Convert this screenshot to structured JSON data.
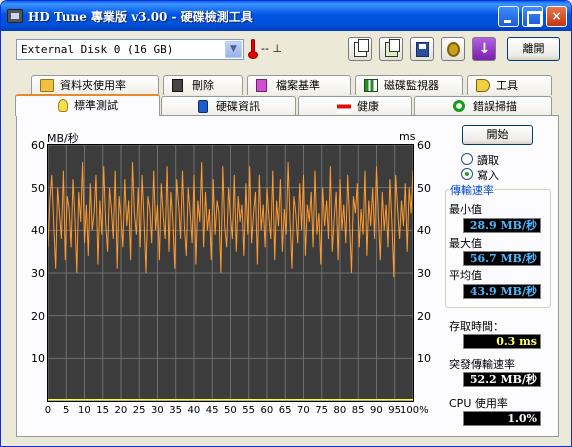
{
  "window": {
    "title": "HD Tune 專業版 v3.00 - 硬碟檢測工具",
    "minimize": "_",
    "maximize": "□",
    "close": "×"
  },
  "toolbar": {
    "drive": "External Disk 0 (16 GB)",
    "temperature": "-- ⊥",
    "exit_label": "離開",
    "download_arrow": "↓"
  },
  "tabs_top": [
    {
      "label": "資料夾使用率",
      "icon": "folder-icon"
    },
    {
      "label": "刪除",
      "icon": "trash-icon"
    },
    {
      "label": "檔案基準",
      "icon": "file-benchmark-icon"
    },
    {
      "label": "磁碟監視器",
      "icon": "disk-monitor-icon"
    },
    {
      "label": "工具",
      "icon": "speaker-icon"
    }
  ],
  "tabs_bottom": [
    {
      "label": "標準測試",
      "icon": "lightbulb-icon",
      "active": true
    },
    {
      "label": "硬碟資訊",
      "icon": "info-icon"
    },
    {
      "label": "健康",
      "icon": "health-cross-icon"
    },
    {
      "label": "錯誤掃描",
      "icon": "magnifier-icon"
    }
  ],
  "controls": {
    "start_label": "開始",
    "read_label": "讀取",
    "write_label": "寫入",
    "mode": "write"
  },
  "stats": {
    "transfer_rate_title": "傳輸速率",
    "min_label": "最小值",
    "min_value": "28.9 MB/秒",
    "max_label": "最大值",
    "max_value": "56.7 MB/秒",
    "avg_label": "平均值",
    "avg_value": "43.9 MB/秒",
    "access_label": "存取時間：",
    "access_value": "0.3 ms",
    "burst_label": "突發傳輸速率",
    "burst_value": "52.2 MB/秒",
    "cpu_label": "CPU 使用率",
    "cpu_value": "1.0%"
  },
  "colors": {
    "transfer": "#ff9a2e",
    "access": "#ffff40",
    "chart_bg": "#3c3c3c",
    "grid": "#6e6e6e"
  },
  "chart_data": {
    "type": "line",
    "left_axis_label": "MB/秒",
    "right_axis_label": "ms",
    "ylim": [
      0,
      60
    ],
    "y_ticks": [
      0,
      10,
      20,
      30,
      40,
      50,
      60
    ],
    "x_ticks": [
      "0",
      "5",
      "10",
      "15",
      "20",
      "25",
      "30",
      "35",
      "40",
      "45",
      "50",
      "55",
      "60",
      "65",
      "70",
      "75",
      "80",
      "85",
      "90",
      "95",
      "100%"
    ],
    "series": [
      {
        "values": [
          36,
          47,
          53,
          41,
          31,
          50,
          44,
          38,
          54,
          33,
          48,
          45,
          36,
          52,
          43,
          30,
          49,
          42,
          56,
          37,
          46,
          34,
          51,
          40,
          44,
          53,
          32,
          47,
          39,
          55,
          42,
          35,
          50,
          45,
          38,
          54,
          31,
          48,
          43,
          36,
          52,
          41,
          47,
          33,
          56,
          44,
          39,
          50,
          36,
          53,
          42,
          30,
          48,
          45,
          37,
          54,
          40,
          46,
          33,
          51,
          43,
          38,
          55,
          35,
          49,
          42,
          31,
          52,
          46,
          38,
          54,
          41,
          34,
          50,
          44,
          37,
          53,
          32,
          47,
          42,
          56,
          36,
          49,
          40,
          45,
          33,
          52,
          39,
          47,
          44,
          30,
          55,
          41,
          36,
          50,
          43,
          38,
          53,
          35,
          48,
          42,
          46,
          34,
          51,
          39,
          55,
          37,
          44,
          49,
          32,
          53,
          40,
          46,
          36,
          50,
          43,
          38,
          54,
          33,
          47,
          41,
          52,
          35,
          45,
          39,
          56,
          42,
          31,
          48,
          44,
          37,
          51,
          40,
          53,
          34,
          46,
          42,
          49,
          36,
          54,
          39,
          44,
          32,
          50,
          41,
          47,
          38,
          55,
          35,
          43,
          49,
          33,
          52,
          40,
          46,
          37,
          53,
          42,
          30,
          48,
          44,
          51,
          36,
          45,
          39,
          54,
          34,
          47,
          41,
          50,
          38,
          55,
          43,
          33,
          49,
          40,
          46,
          36,
          52,
          42,
          29,
          53,
          45,
          38,
          47,
          41,
          51,
          35,
          50,
          44,
          54
        ]
      },
      {
        "values": [
          0.3,
          0.3,
          0.3,
          0.3,
          0.3,
          0.3,
          0.3,
          0.3,
          0.3,
          0.3,
          0.3,
          0.3,
          0.3,
          0.3,
          0.3,
          0.3,
          0.3,
          0.3,
          0.3,
          0.3,
          0.3
        ]
      }
    ]
  }
}
